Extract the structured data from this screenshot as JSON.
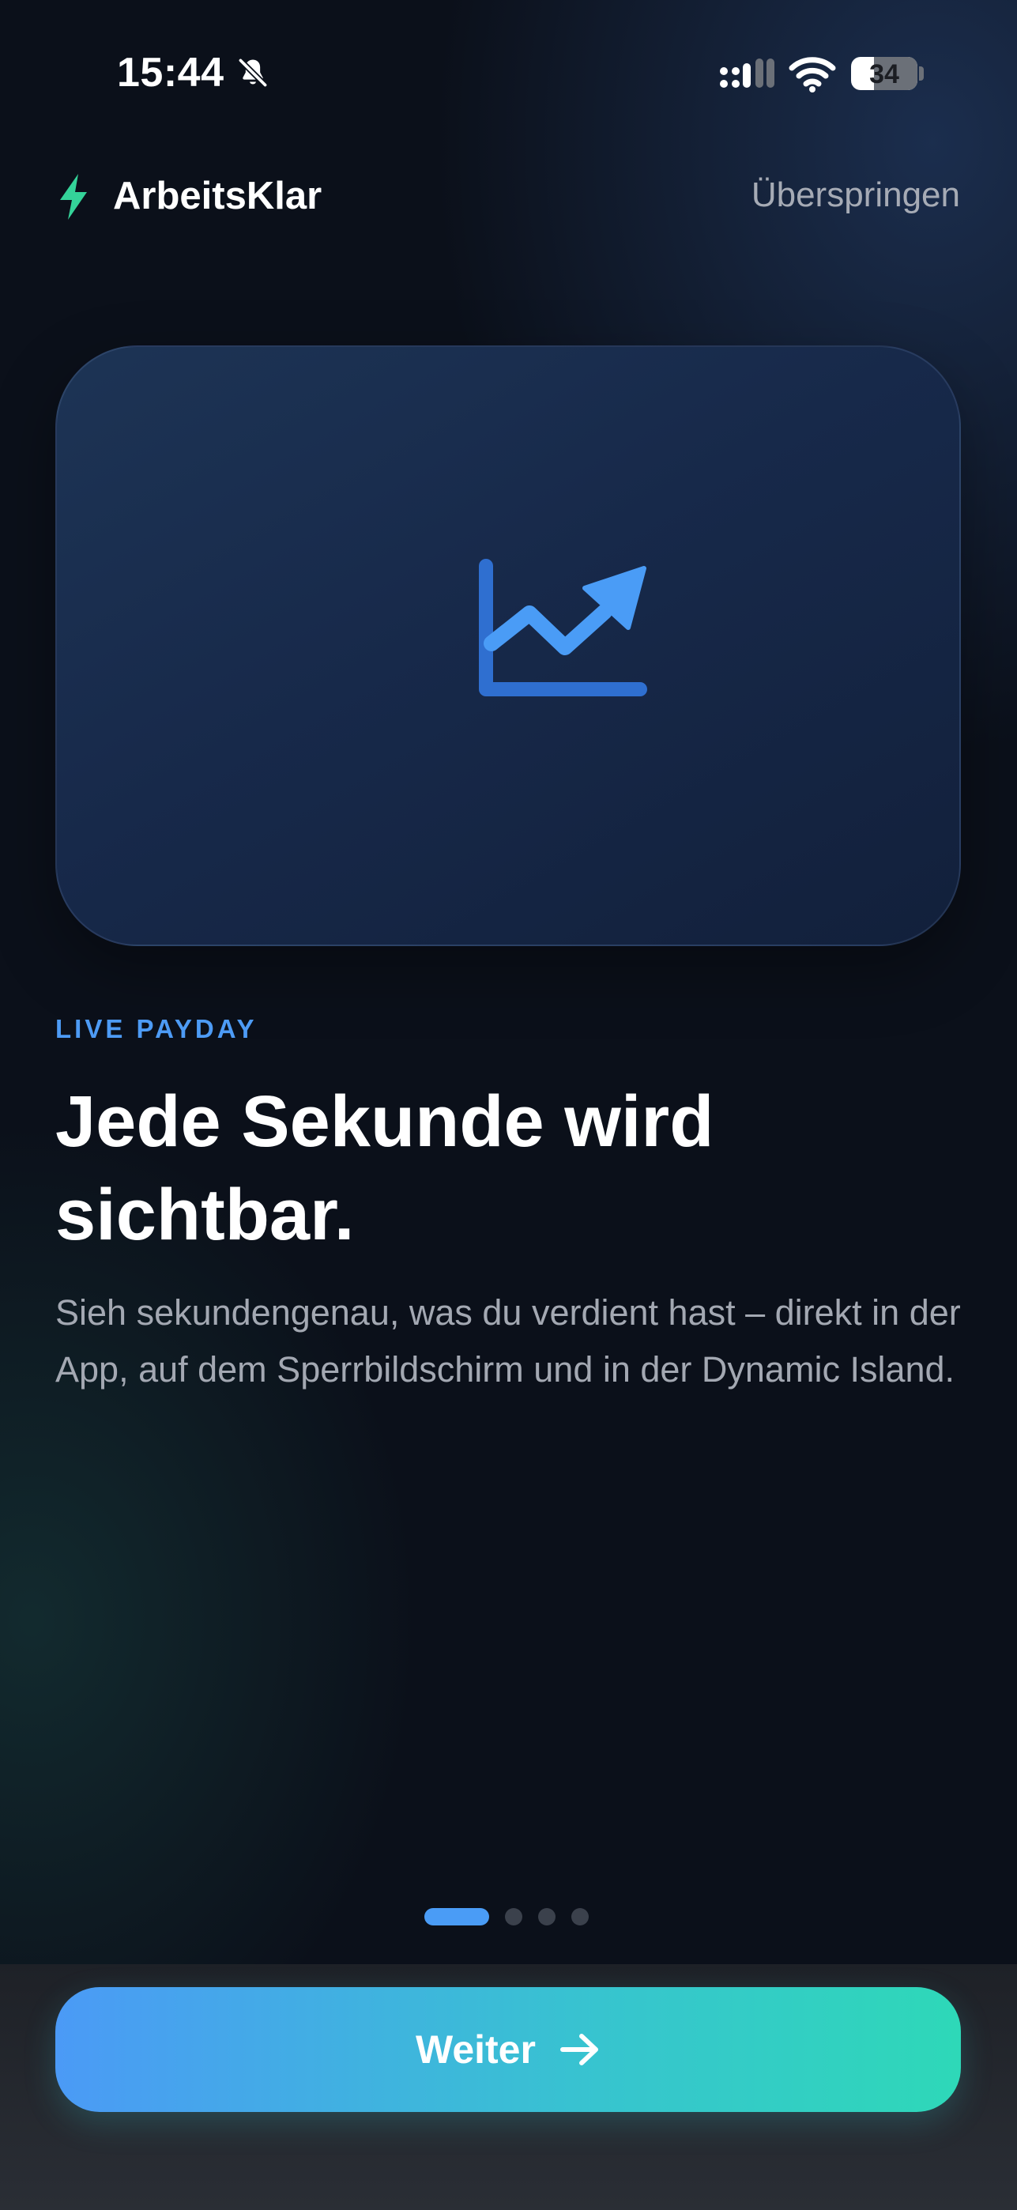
{
  "status_bar": {
    "time": "15:44",
    "battery_level": "34",
    "icons": [
      "bell-slash-icon",
      "cellular-signal-icon",
      "wifi-icon",
      "battery-icon"
    ]
  },
  "header": {
    "app_name": "ArbeitsKlar",
    "logo_icon": "bolt-icon",
    "skip_label": "Überspringen"
  },
  "hero": {
    "icon": "chart-line-uptrend-icon"
  },
  "content": {
    "eyebrow": "LIVE PAYDAY",
    "headline": "Jede Sekunde wird sichtbar.",
    "body": "Sieh sekundengenau, was du verdient hast – direkt in der App, auf dem Sperrbildschirm und in der Dynamic Island."
  },
  "pager": {
    "total_pages": 4,
    "current_page": 1
  },
  "footer": {
    "continue_label": "Weiter",
    "continue_icon": "arrow-right-icon"
  },
  "colors": {
    "accent_blue": "#4a9cf6",
    "accent_green": "#2ed8b8",
    "logo_green": "#34d399",
    "background": "#0b101a"
  }
}
